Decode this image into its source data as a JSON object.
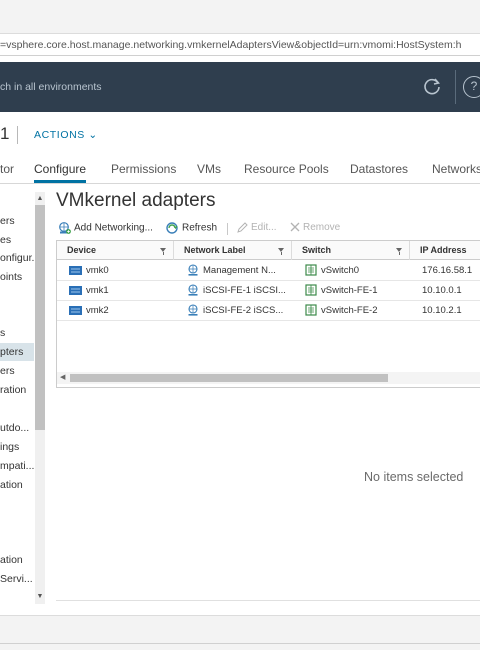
{
  "browser": {
    "url_fragment": "=vsphere.core.host.manage.networking.vmkernelAdaptersView&objectId=urn:vmomi:HostSystem:h"
  },
  "header": {
    "search_text": "ch in all environments",
    "help_glyph": "?"
  },
  "object": {
    "title_fragment": "1",
    "actions_label": "ACTIONS ⌄"
  },
  "tabs": [
    {
      "label": "tor"
    },
    {
      "label": "Configure"
    },
    {
      "label": "Permissions"
    },
    {
      "label": "VMs"
    },
    {
      "label": "Resource Pools"
    },
    {
      "label": "Datastores"
    },
    {
      "label": "Networks"
    }
  ],
  "left_nav": {
    "items": [
      {
        "label": "ers"
      },
      {
        "label": "es"
      },
      {
        "label": "onfigur..."
      },
      {
        "label": "oints"
      },
      {
        "label": "s"
      },
      {
        "label": "pters"
      },
      {
        "label": "ers"
      },
      {
        "label": "ration"
      },
      {
        "label": "utdo..."
      },
      {
        "label": "ings"
      },
      {
        "label": "mpati..."
      },
      {
        "label": "ation"
      },
      {
        "label": "ation"
      },
      {
        "label": "Servi..."
      }
    ],
    "selected_index": 5
  },
  "content": {
    "title": "VMkernel adapters",
    "toolbar": {
      "add_networking": "Add Networking...",
      "refresh": "Refresh",
      "edit": "Edit...",
      "remove": "Remove"
    },
    "columns": [
      "Device",
      "Network Label",
      "Switch",
      "IP Address"
    ],
    "rows": [
      {
        "device": "vmk0",
        "network_label": "Management N...",
        "switch": "vSwitch0",
        "ip": "176.16.58.1"
      },
      {
        "device": "vmk1",
        "network_label": "iSCSI-FE-1 iSCSI...",
        "switch": "vSwitch-FE-1",
        "ip": "10.10.0.1"
      },
      {
        "device": "vmk2",
        "network_label": "iSCSI-FE-2 iSCS...",
        "switch": "vSwitch-FE-2",
        "ip": "10.10.2.1"
      }
    ],
    "detail_empty_text": "No items selected"
  },
  "colors": {
    "header_bg": "#2f3e4e",
    "accent": "#0072a3",
    "selected_nav_bg": "#d8e3e9"
  }
}
